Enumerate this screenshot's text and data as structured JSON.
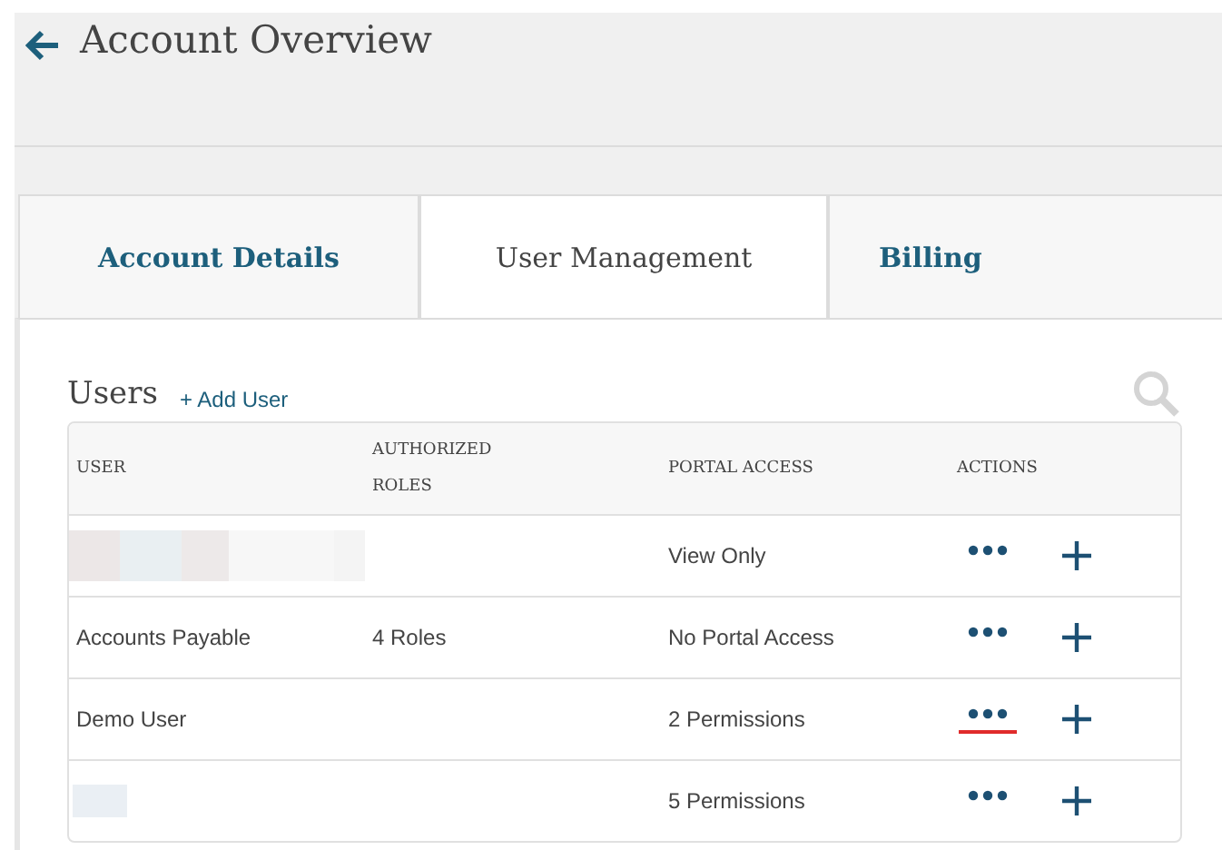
{
  "page": {
    "title": "Account Overview"
  },
  "tabs": [
    {
      "label": "Account Details",
      "selected": false
    },
    {
      "label": "User Management",
      "selected": true
    },
    {
      "label": "Billing",
      "selected": false
    }
  ],
  "users": {
    "title": "Users",
    "add_link": "+ Add User",
    "columns": [
      "USER",
      "AUTHORIZED ROLES",
      "PORTAL ACCESS",
      "ACTIONS"
    ],
    "rows": [
      {
        "kind": "blurred",
        "user": "",
        "roles": "",
        "access": "View Only",
        "highlighted": false
      },
      {
        "kind": "text",
        "user": "Accounts Payable",
        "roles": "4 Roles",
        "access": "No Portal Access",
        "highlighted": false
      },
      {
        "kind": "text",
        "user": "Demo User",
        "roles": "",
        "access": "2 Permissions",
        "highlighted": true
      },
      {
        "kind": "masked",
        "user": "",
        "roles": "",
        "access": "5 Permissions",
        "highlighted": false
      }
    ]
  }
}
